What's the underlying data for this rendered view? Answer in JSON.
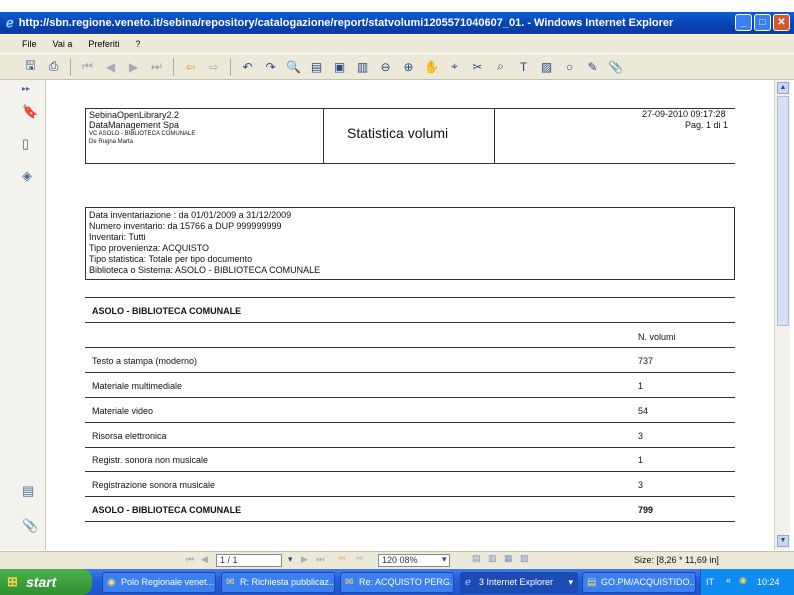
{
  "window": {
    "title": "http://sbn.regione.veneto.it/sebina/repository/catalogazione/report/statvolumi1205571040607_01. - Windows Internet Explorer",
    "minimize": "_",
    "maximize": "□",
    "close": "✕"
  },
  "menu": {
    "items": [
      "File",
      "Vai a",
      "Preferiti",
      "?"
    ]
  },
  "toolbar": {
    "icons": [
      "save-icon",
      "print-icon",
      "first-page-icon",
      "prev-page-icon",
      "next-page-icon",
      "last-page-icon",
      "back-icon",
      "forward-icon",
      "rotate-left-icon",
      "rotate-right-icon",
      "zoom-in-icon",
      "single-page-icon",
      "fit-page-icon",
      "fit-width-icon",
      "zoom-out-icon",
      "zoom-plus-icon",
      "hand-tool-icon",
      "select-tool-icon",
      "snapshot-icon",
      "find-icon",
      "text-icon",
      "image-icon",
      "circle-icon",
      "highlight-icon",
      "attach-icon"
    ]
  },
  "report": {
    "header": {
      "left_line1": "SebinaOpenLibrary2.2",
      "left_line2": "DataManagement Spa",
      "left_line3": "VC ASOLO - BIBLIOTECA COMUNALE",
      "left_line4": "De Rugna Marta",
      "title": "Statistica volumi",
      "date": "27-09-2010 09:17:28",
      "page": "Pag. 1 di 1"
    },
    "criteria": [
      "Data inventariazione : da 01/01/2009 a 31/12/2009",
      "Numero inventario: da 15766 a DUP 999999999",
      "Inventari: Tutti",
      "Tipo provenienza: ACQUISTO",
      "Tipo statistica: Totale per tipo documento",
      "Biblioteca o Sistema: ASOLO - BIBLIOTECA COMUNALE"
    ],
    "section_title": "ASOLO - BIBLIOTECA COMUNALE",
    "column_header": "N. volumi",
    "rows": [
      {
        "label": "Testo a stampa (moderno)",
        "value": "737"
      },
      {
        "label": "Materiale multimediale",
        "value": "1"
      },
      {
        "label": "Materiale video",
        "value": "54"
      },
      {
        "label": "Risorsa elettronica",
        "value": "3"
      },
      {
        "label": "Registr. sonora non musicale",
        "value": "1"
      },
      {
        "label": "Registrazione sonora musicale",
        "value": "3"
      }
    ],
    "total_label": "ASOLO - BIBLIOTECA COMUNALE",
    "total_value": "799"
  },
  "pdfbar": {
    "page_field": "1 / 1",
    "zoom": "120 08%",
    "size": "Size: [8,26 * 11,69 in]"
  },
  "taskbar": {
    "start": "start",
    "tasks": [
      "Polo Regionale venet...",
      "R: Richiesta pubblicaz...",
      "Re: ACQUISTO PERG...",
      "3 Internet Explorer",
      "GO.PM/ACQUISTIDO..."
    ],
    "lang": "IT",
    "clock": "10:24"
  },
  "colors": {
    "title_bar": "#0842b0",
    "chrome": "#ece9d8",
    "taskbar": "#245edb",
    "start_button": "#2f8f2f"
  }
}
